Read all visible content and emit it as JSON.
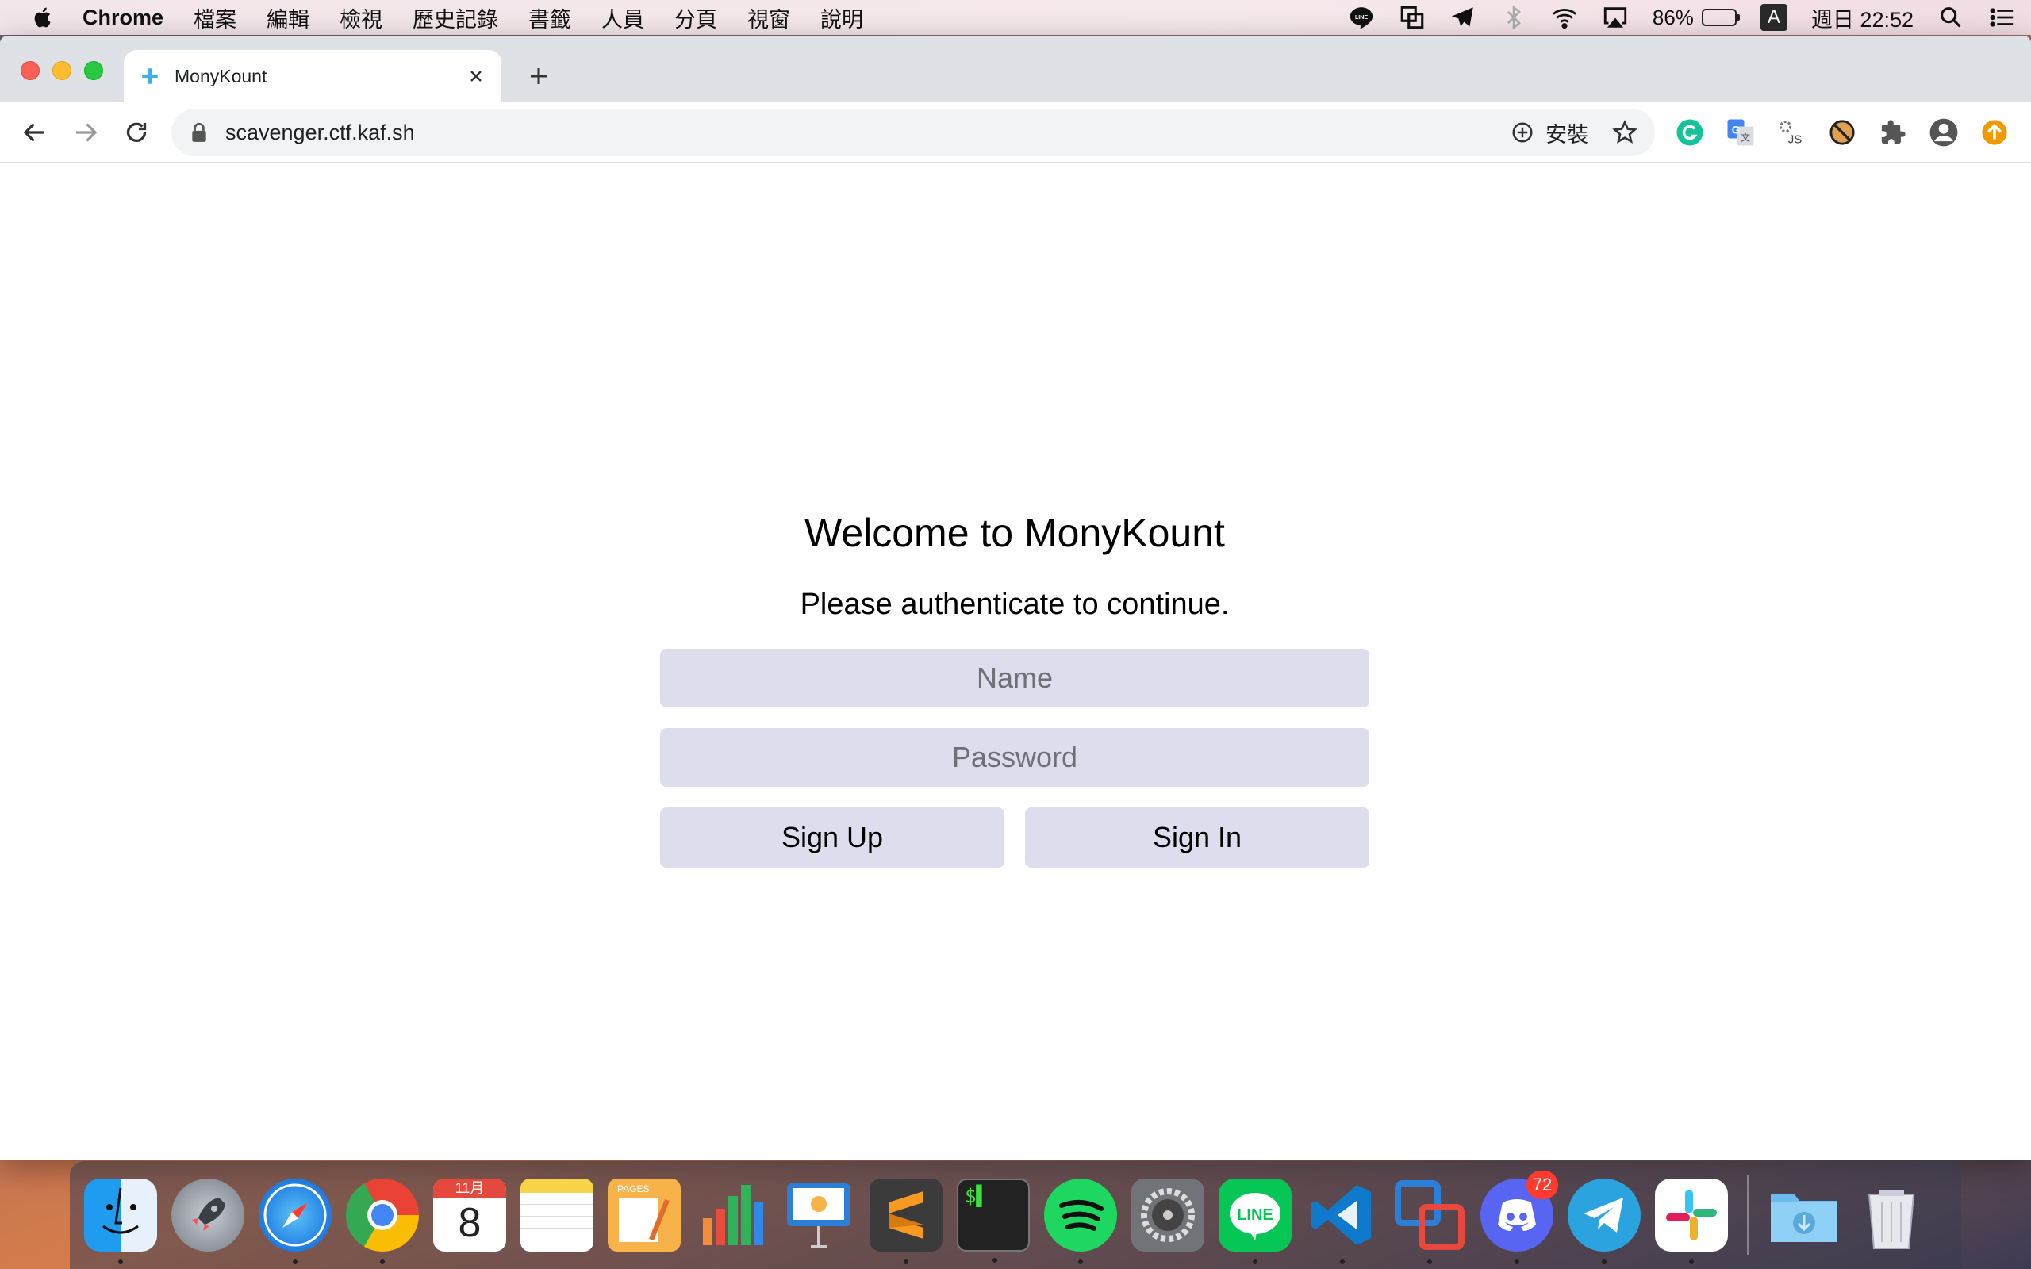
{
  "menubar": {
    "app_name": "Chrome",
    "items": [
      "檔案",
      "編輯",
      "檢視",
      "歷史記錄",
      "書籤",
      "人員",
      "分頁",
      "視窗",
      "說明"
    ],
    "battery_percent": "86%",
    "battery_level": 0.86,
    "input_source": "A",
    "clock": "週日 22:52"
  },
  "browser": {
    "tab_title": "MonyKount",
    "url": "scavenger.ctf.kaf.sh",
    "install_label": "安裝"
  },
  "page": {
    "heading": "Welcome to MonyKount",
    "subheading": "Please authenticate to continue.",
    "name_placeholder": "Name",
    "password_placeholder": "Password",
    "signup_label": "Sign Up",
    "signin_label": "Sign In"
  },
  "dock": {
    "calendar_month": "11月",
    "calendar_day": "8",
    "pages_label": "PAGES",
    "discord_badge": "72",
    "line_label": "LINE"
  },
  "colors": {
    "field_bg": "#dcdeee",
    "accent_tab_icon": "#3db0e4"
  }
}
